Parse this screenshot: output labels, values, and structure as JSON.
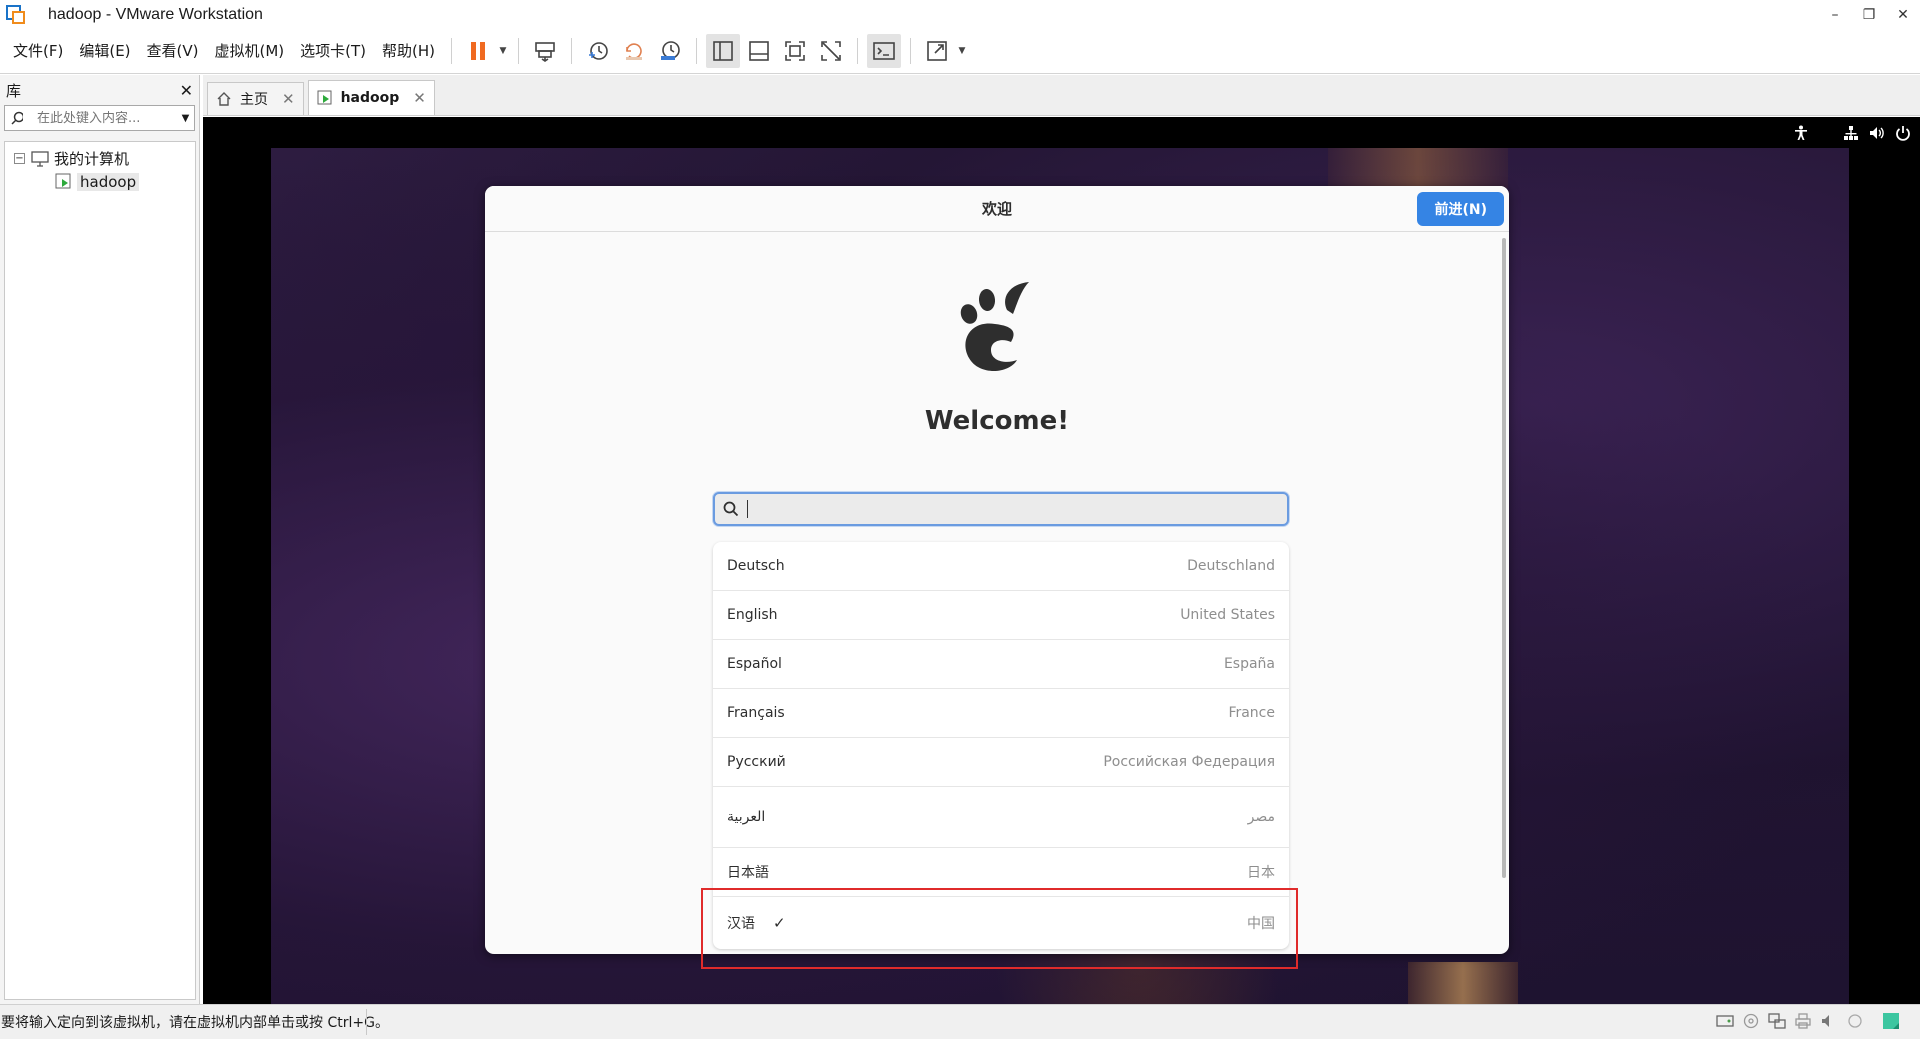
{
  "window": {
    "title": "hadoop - VMware Workstation",
    "minimize": "–",
    "restore": "❐",
    "close": "✕"
  },
  "menu": [
    "文件(F)",
    "编辑(E)",
    "查看(V)",
    "虚拟机(M)",
    "选项卡(T)",
    "帮助(H)"
  ],
  "toolbar_icons": [
    "pause-icon",
    "send-ctrl-alt-del-icon",
    "snapshot-icon",
    "revert-snapshot-icon",
    "snapshot-manager-icon",
    "library-view-icon",
    "thumbnail-view-icon",
    "fullscreen-icon",
    "unity-icon",
    "console-icon",
    "stretch-icon"
  ],
  "library": {
    "title": "库",
    "close": "✕",
    "search_placeholder": "在此处键入内容...",
    "tree": {
      "root_toggle": "−",
      "root_label": "我的计算机",
      "child_label": "hadoop"
    }
  },
  "tabs": [
    {
      "label": "主页",
      "icon": "home-icon",
      "close": "✕"
    },
    {
      "label": "hadoop",
      "icon": "vm-icon",
      "close": "✕"
    }
  ],
  "gnome_setup": {
    "header_title": "欢迎",
    "next_button": "前进(N)",
    "welcome": "Welcome!",
    "search_value": "",
    "languages": [
      {
        "name": "Deutsch",
        "region": "Deutschland"
      },
      {
        "name": "English",
        "region": "United States"
      },
      {
        "name": "Español",
        "region": "España"
      },
      {
        "name": "Français",
        "region": "France"
      },
      {
        "name": "Русский",
        "region": "Российская Федерация"
      },
      {
        "name": "العربية",
        "region": "مصر"
      },
      {
        "name": "日本語",
        "region": "日本"
      },
      {
        "name": "汉语",
        "region": "中国",
        "selected": true,
        "check": "✓"
      }
    ]
  },
  "status": {
    "text": "要将输入定向到该虚拟机，请在虚拟机内部单击或按 Ctrl+G。"
  },
  "colors": {
    "accent": "#3584e4",
    "highlight": "#e02b2b",
    "pause": "#f06a21"
  }
}
